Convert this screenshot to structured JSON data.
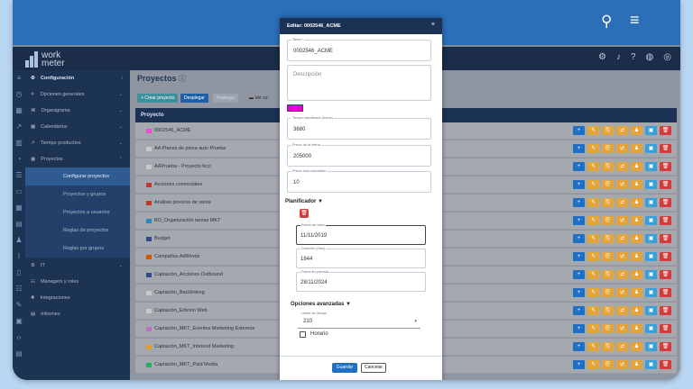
{
  "colors": {
    "accent": "#1f6fc4",
    "header": "#1b3254",
    "color_swatch": "#e800e0",
    "delete": "#d43b3b"
  },
  "topbar": {
    "search_icon": "search-icon",
    "menu_icon": "hamburger-icon"
  },
  "app": {
    "logo_line1": "work",
    "logo_line2": "meter",
    "tools": [
      "gear-icon",
      "bell-icon",
      "help-icon",
      "globe-icon",
      "user-icon"
    ]
  },
  "sidebar": {
    "header": "Configuración",
    "items": [
      "Opciones generales",
      "Organigrama",
      "Calendarios",
      "Tiempo productivo",
      "Proyectos"
    ],
    "sub_items": [
      "Configurar proyectos",
      "Proyectos y grupos",
      "Proyectos a usuarios",
      "Reglas de proyectos",
      "Reglas por grupos"
    ],
    "bottom_items": [
      "IT",
      "Managers y roles",
      "Integraciones",
      "Informes"
    ]
  },
  "main": {
    "title": "Proyectos",
    "buttons": {
      "create": "+ Crear proyecto",
      "expand": "Desplegar",
      "collapse": "Replegar",
      "view": "Ver co"
    },
    "column": "Proyecto",
    "rows": [
      {
        "name": "0002546_ACME",
        "color": "#e94fd0"
      },
      {
        "name": "AA Planos de pieza auto Prueba",
        "color": "#c9c9c9"
      },
      {
        "name": "AAPrueba - Proyecto ficci",
        "color": "#c9c9c9"
      },
      {
        "name": "Acciones comerciales",
        "color": "#c0392b"
      },
      {
        "name": "Análisis proceso de venta",
        "color": "#c0392b"
      },
      {
        "name": "BO_Organización tareas MKT",
        "color": "#2e86c1"
      },
      {
        "name": "Budget",
        "color": "#2e4a8a"
      },
      {
        "name": "Campañas AdWords",
        "color": "#d35400"
      },
      {
        "name": "Captación_Acciones Outbound",
        "color": "#2e4a8a"
      },
      {
        "name": "Captación_Backlinking",
        "color": "#c9c9c9"
      },
      {
        "name": "Captación_Edicion Web",
        "color": "#c9c9c9"
      },
      {
        "name": "Captación_MKT_Eventos Marketing Externos",
        "color": "#c070c0"
      },
      {
        "name": "Captación_MKT_Inbound Marketing",
        "color": "#e39a2c"
      },
      {
        "name": "Captación_MKT_Paid Media",
        "color": "#27ae60"
      }
    ]
  },
  "modal": {
    "title": "Editar: 0002546_ACME",
    "close": "×",
    "tarea_label": "Tarea *",
    "tarea_value": "0002546_ACME",
    "descripcion_placeholder": "Descripción",
    "tiempo_label": "Tiempo planificado (horas)",
    "tiempo_value": "3680",
    "precio_label": "Precio de la oferta",
    "precio_value": "205000",
    "precio_hora_label": "Precio hora facturable",
    "precio_hora_value": "10",
    "planificador": "Planificador ▼",
    "fecha_inicio_label": "Fecha de inicio",
    "fecha_inicio_value": "11/11/2019",
    "duracion_label": "Duración (días)",
    "duracion_value": "1844",
    "fecha_fin_label": "Fecha fin prevista",
    "fecha_fin_value": "28/11/2024",
    "opciones": "Opciones avanzadas ▼",
    "limite_label": "Límite de tiempo",
    "limite_value": "210",
    "horario": "Horario",
    "save": "Guardar",
    "cancel": "Cancelar"
  }
}
